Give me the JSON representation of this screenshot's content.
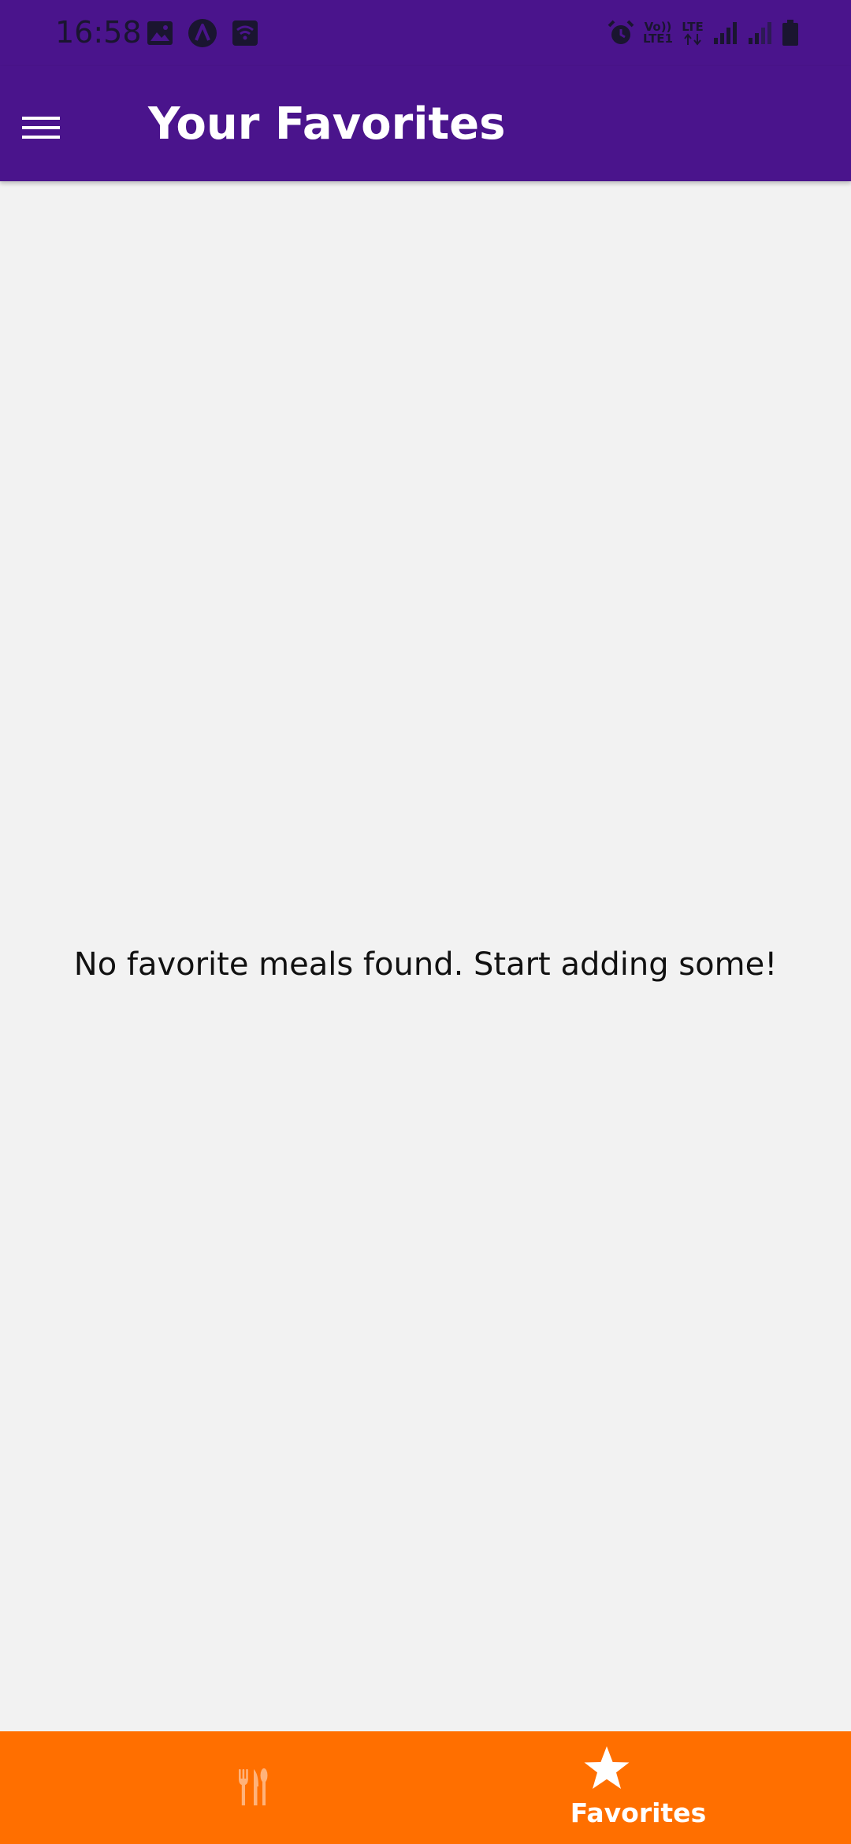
{
  "status_bar": {
    "time": "16:58",
    "left_icons": [
      "gallery-icon",
      "app-a-icon",
      "wifi-calling-icon"
    ],
    "right_icons": [
      "alarm-icon",
      "volte-icon",
      "lte-icon",
      "signal-icon",
      "signal-icon-2",
      "battery-icon"
    ],
    "volte_top": "Vo))",
    "volte_bottom": "LTE1",
    "lte_label": "LTE"
  },
  "app_bar": {
    "title": "Your Favorites",
    "menu_icon": "hamburger-menu-icon",
    "background_color": "#4a148c"
  },
  "content": {
    "empty_message": "No favorite meals found. Start adding some!"
  },
  "tab_bar": {
    "background_color": "#ff6f00",
    "tabs": [
      {
        "icon": "restaurant-icon",
        "label": "",
        "active": false
      },
      {
        "icon": "star-icon",
        "label": "Favorites",
        "active": true
      }
    ]
  }
}
